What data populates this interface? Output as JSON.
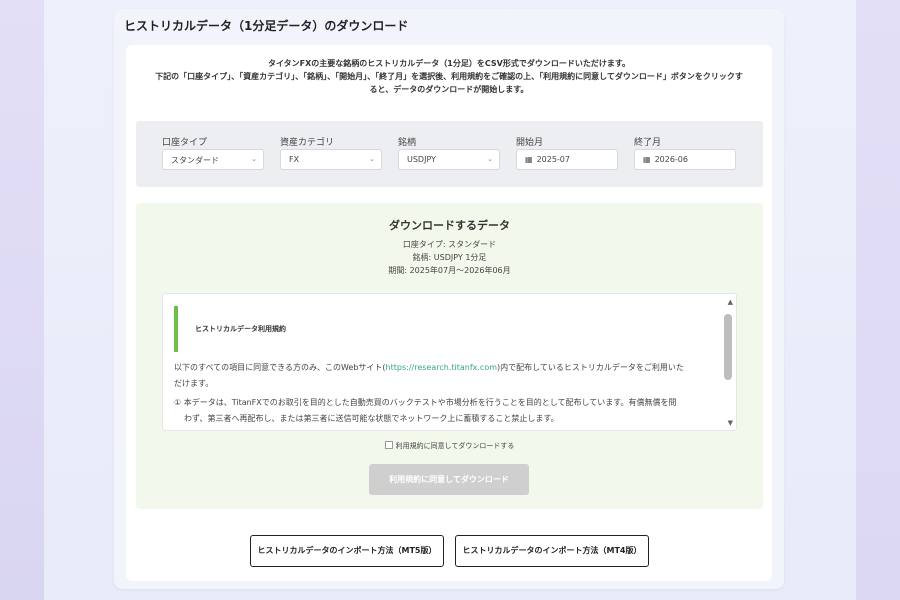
{
  "card": {
    "title": "ヒストリカルデータ（1分足データ）のダウンロード"
  },
  "intro": {
    "line1": "タイタンFXの主要な銘柄のヒストリカルデータ（1分足）をCSV形式でダウンロードいただけます。",
    "line2": "下記の「口座タイプ」、「資産カテゴリ」、「銘柄」、「開始月」、「終了月」を選択後、利用規約をご確認の上、「利用規約に同意してダウンロード」ボタンをクリックす",
    "line3": "ると、データのダウンロードが開始します。"
  },
  "filters": {
    "account_type": {
      "label": "口座タイプ",
      "value": "スタンダード"
    },
    "asset_category": {
      "label": "資産カテゴリ",
      "value": "FX"
    },
    "symbol": {
      "label": "銘柄",
      "value": "USDJPY"
    },
    "start_month": {
      "label": "開始月",
      "value": "2025-07"
    },
    "end_month": {
      "label": "終了月",
      "value": "2026-06"
    }
  },
  "download": {
    "title": "ダウンロードするデータ",
    "account_line": "口座タイプ: スタンダード",
    "symbol_line": "銘柄: USDJPY 1分足",
    "period_line": "期間: 2025年07月〜2026年06月"
  },
  "terms": {
    "title": "ヒストリカルデータ利用規約",
    "p1_before": "以下のすべての項目に同意できる方のみ、このWebサイト(",
    "p1_link": "https://research.titanfx.com",
    "p1_after": ")内で配布しているヒストリカルデータをご利用いた",
    "p1_cont": "だけます。",
    "p2": "① 本データは、TitanFXでのお取引を目的とした自動売買のバックテストや市場分析を行うことを目的として配布しています。有償無償を問",
    "p2_cont": "わず、第三者へ再配布し、または第三者に送信可能な状態でネットワーク上に蓄積すること禁止します。"
  },
  "agree_label": "利用規約に同意してダウンロードする",
  "download_button": "利用規約に同意してダウンロード",
  "import_mt5": "ヒストリカルデータのインポート方法（MT5版）",
  "import_mt4": "ヒストリカルデータのインポート方法（MT4版）"
}
